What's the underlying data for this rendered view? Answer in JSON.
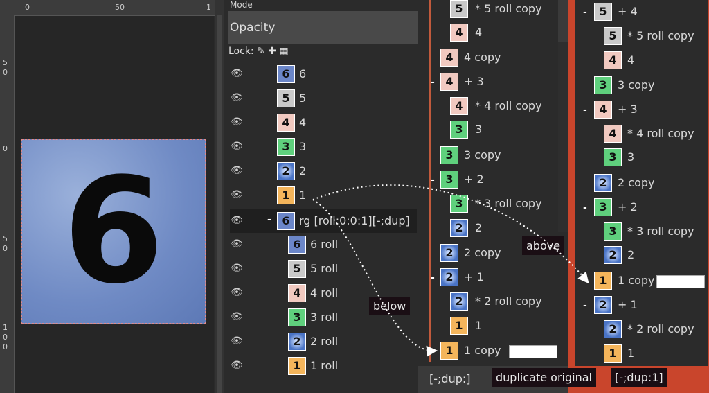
{
  "ruler": {
    "top_ticks": [
      "0",
      "50",
      "1"
    ],
    "left_ticks": [
      "5",
      "0",
      "0",
      "5",
      "0",
      "1",
      "0",
      "0"
    ]
  },
  "canvas": {
    "digit": "6"
  },
  "layers_panel": {
    "mode_label": "Mode",
    "opacity_label": "Opacity",
    "lock_label": "Lock:",
    "lock_icons": [
      "pencil-icon",
      "move-icon",
      "checker-icon"
    ],
    "layers": [
      {
        "thumb": "6",
        "color": "blue",
        "label": "6"
      },
      {
        "thumb": "5",
        "color": "gray",
        "label": "5"
      },
      {
        "thumb": "4",
        "color": "pink",
        "label": "4"
      },
      {
        "thumb": "3",
        "color": "green",
        "label": "3"
      },
      {
        "thumb": "2",
        "color": "water",
        "label": "2"
      },
      {
        "thumb": "1",
        "color": "orange",
        "label": "1"
      },
      {
        "thumb": "6",
        "color": "blue",
        "label": "rg [roll:0:0:1][-;dup]"
      },
      {
        "thumb": "6",
        "color": "blue",
        "label": "6 roll"
      },
      {
        "thumb": "5",
        "color": "gray",
        "label": "5 roll"
      },
      {
        "thumb": "4",
        "color": "pink",
        "label": "4 roll"
      },
      {
        "thumb": "3",
        "color": "green",
        "label": "3 roll"
      },
      {
        "thumb": "2",
        "color": "water",
        "label": "2 roll"
      },
      {
        "thumb": "1",
        "color": "orange",
        "label": "1 roll"
      }
    ]
  },
  "middle_panel": {
    "items": [
      {
        "thumb": "5",
        "color": "gray",
        "label": "* 5 roll copy"
      },
      {
        "thumb": "4",
        "color": "pink",
        "label": "4"
      },
      {
        "thumb": "4",
        "color": "pink",
        "label": "4 copy"
      },
      {
        "thumb": "4",
        "color": "pink",
        "label": "+ 3"
      },
      {
        "thumb": "4",
        "color": "pink",
        "label": "* 4 roll copy"
      },
      {
        "thumb": "3",
        "color": "green",
        "label": "3"
      },
      {
        "thumb": "3",
        "color": "green",
        "label": "3 copy"
      },
      {
        "thumb": "3",
        "color": "green",
        "label": "+ 2"
      },
      {
        "thumb": "3",
        "color": "green",
        "label": "* 3 roll copy"
      },
      {
        "thumb": "2",
        "color": "water",
        "label": "2"
      },
      {
        "thumb": "2",
        "color": "water",
        "label": "2 copy"
      },
      {
        "thumb": "2",
        "color": "water",
        "label": "+ 1"
      },
      {
        "thumb": "2",
        "color": "water",
        "label": "* 2 roll copy"
      },
      {
        "thumb": "1",
        "color": "orange",
        "label": "1"
      },
      {
        "thumb": "1",
        "color": "orange",
        "label": "1 copy"
      }
    ],
    "caption": "[-;dup:]"
  },
  "right_panel": {
    "items": [
      {
        "thumb": "5",
        "color": "gray",
        "label": "+ 4"
      },
      {
        "thumb": "5",
        "color": "gray",
        "label": "* 5 roll copy"
      },
      {
        "thumb": "4",
        "color": "pink",
        "label": "4"
      },
      {
        "thumb": "3",
        "color": "green",
        "label": "3 copy"
      },
      {
        "thumb": "4",
        "color": "pink",
        "label": "+ 3"
      },
      {
        "thumb": "4",
        "color": "pink",
        "label": "* 4 roll copy"
      },
      {
        "thumb": "3",
        "color": "green",
        "label": "3"
      },
      {
        "thumb": "2",
        "color": "water",
        "label": "2 copy"
      },
      {
        "thumb": "3",
        "color": "green",
        "label": "+ 2"
      },
      {
        "thumb": "3",
        "color": "green",
        "label": "* 3 roll copy"
      },
      {
        "thumb": "2",
        "color": "water",
        "label": "2"
      },
      {
        "thumb": "1",
        "color": "orange",
        "label": "1 copy"
      },
      {
        "thumb": "2",
        "color": "water",
        "label": "+ 1"
      },
      {
        "thumb": "2",
        "color": "water",
        "label": "* 2 roll copy"
      },
      {
        "thumb": "1",
        "color": "orange",
        "label": "1"
      }
    ],
    "caption": "[-;dup:1]"
  },
  "annotations": {
    "below": "below",
    "above": "above",
    "duplicate": "duplicate original"
  }
}
